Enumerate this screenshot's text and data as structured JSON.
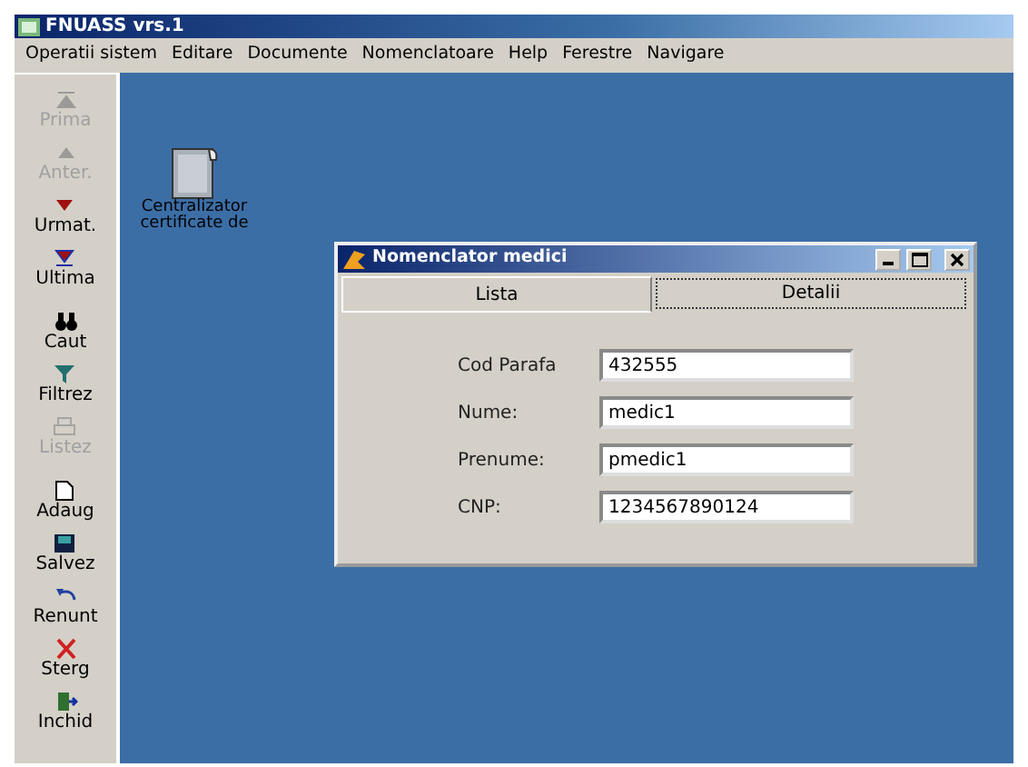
{
  "window": {
    "title": "FNUASS vrs.1"
  },
  "menu": [
    "Operatii sistem",
    "Editare",
    "Documente",
    "Nomenclatoare",
    "Help",
    "Ferestre",
    "Navigare"
  ],
  "toolbar": [
    {
      "label": "Prima",
      "kind": "first",
      "disabled": true
    },
    {
      "label": "Anter.",
      "kind": "prev",
      "disabled": true
    },
    {
      "label": "Urmat.",
      "kind": "next",
      "disabled": false
    },
    {
      "label": "Ultima",
      "kind": "last",
      "disabled": false
    },
    {
      "label": "Caut",
      "kind": "find",
      "disabled": false
    },
    {
      "label": "Filtrez",
      "kind": "filter",
      "disabled": false
    },
    {
      "label": "Listez",
      "kind": "print",
      "disabled": true
    },
    {
      "label": "Adaug",
      "kind": "new",
      "disabled": false
    },
    {
      "label": "Salvez",
      "kind": "save",
      "disabled": false
    },
    {
      "label": "Renunt",
      "kind": "undo",
      "disabled": false
    },
    {
      "label": "Sterg",
      "kind": "delete",
      "disabled": false
    },
    {
      "label": "Inchid",
      "kind": "exit",
      "disabled": false
    }
  ],
  "desktop_icon": {
    "label": "Centralizator certificate de"
  },
  "dialog": {
    "title": "Nomenclator medici",
    "tabs": [
      {
        "label": "Lista",
        "selected": false
      },
      {
        "label": "Detalii",
        "selected": true
      }
    ],
    "fields": [
      {
        "label": "Cod Parafa",
        "value": "432555"
      },
      {
        "label": "Nume:",
        "value": "medic1"
      },
      {
        "label": "Prenume:",
        "value": "pmedic1"
      },
      {
        "label": "CNP:",
        "value": "1234567890124"
      }
    ]
  }
}
